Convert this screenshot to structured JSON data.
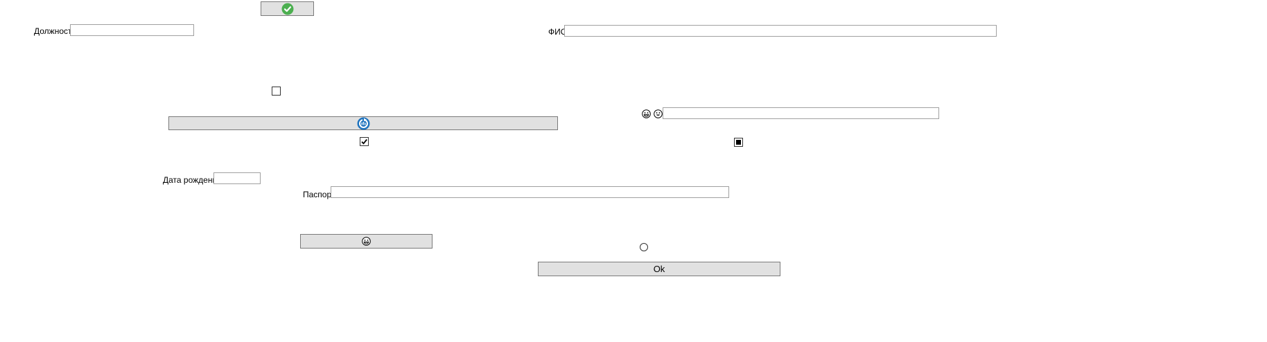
{
  "form": {
    "position_label": "Должность",
    "position_value": "",
    "fio_label": "ФИО",
    "fio_value": "",
    "birthdate_label": "Дата рождения",
    "birthdate_value": "",
    "passport_label": "Паспорт",
    "passport_value": "",
    "emoji_field_value": "",
    "ok_label": "Ok"
  },
  "icons": {
    "top_button": "check-circle-icon",
    "wide_button": "refresh-icon",
    "small_button": "grinning-face-icon",
    "emoji_1": "grinning-face-icon",
    "emoji_2": "smiling-face-icon"
  },
  "checkboxes": {
    "first_checked": false,
    "second_checked": true,
    "third_state": "indeterminate"
  },
  "radio": {
    "selected": false
  },
  "colors": {
    "accent_green": "#4caf50",
    "accent_blue": "#1e73be",
    "button_bg": "#e1e1e1"
  }
}
